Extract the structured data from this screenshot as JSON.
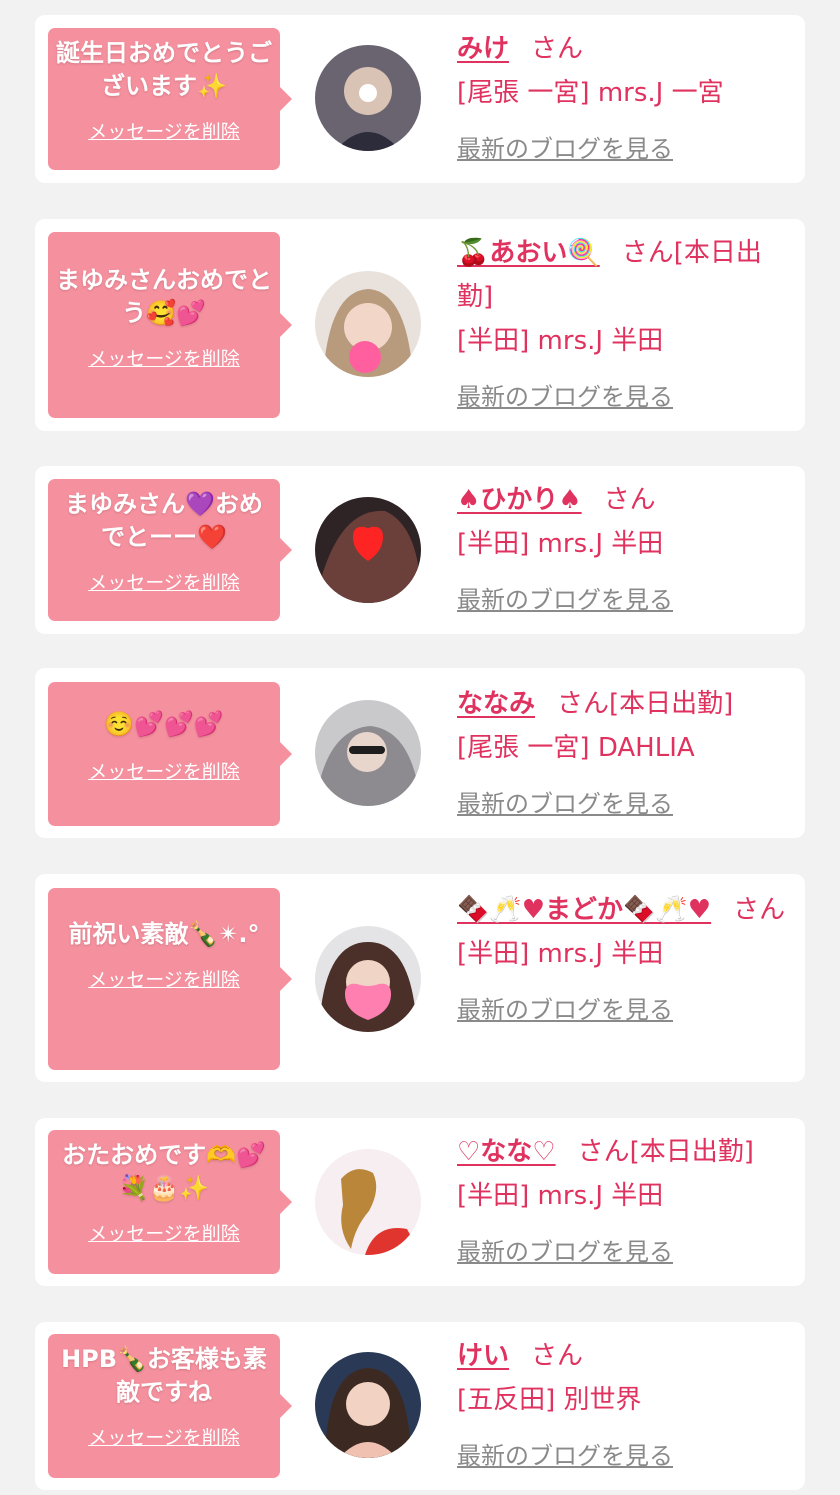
{
  "delete_label": "メッセージを削除",
  "blog_label": "最新のブログを見る",
  "honorific": "さん",
  "colors": {
    "bubble": "#f5909e",
    "accent": "#e0325f",
    "link_gray": "#8a8a8a",
    "background": "#f2f2f2"
  },
  "entries": [
    {
      "message": "誕生日おめでとうございます✨",
      "name": "みけ",
      "status": "",
      "shop": "[尾張 一宮] mrs.J 一宮"
    },
    {
      "message": "まゆみさんおめでとう🥰💕",
      "name": "🍒あおい🍭",
      "status": "[本日出勤]",
      "shop": "[半田] mrs.J 半田"
    },
    {
      "message": "まゆみさん💜おめでとーー❤️",
      "name": "♠ひかり♠",
      "status": "",
      "shop": "[半田] mrs.J 半田"
    },
    {
      "message": "☺️💕💕💕",
      "name": "ななみ",
      "status": "[本日出勤]",
      "shop": "[尾張 一宮] DAHLIA"
    },
    {
      "message": "前祝い素敵🍾✴︎.°",
      "name": "🍫🥂♥まどか🍫🥂♥",
      "status": "",
      "shop": "[半田] mrs.J 半田"
    },
    {
      "message": "おたおめです🫶💕💐🎂✨",
      "name": "♡なな♡",
      "status": "[本日出勤]",
      "shop": "[半田] mrs.J 半田"
    },
    {
      "message": "HPB🍾お客様も素敵ですね",
      "name": "けい",
      "status": "",
      "shop": "[五反田] 別世界"
    }
  ]
}
